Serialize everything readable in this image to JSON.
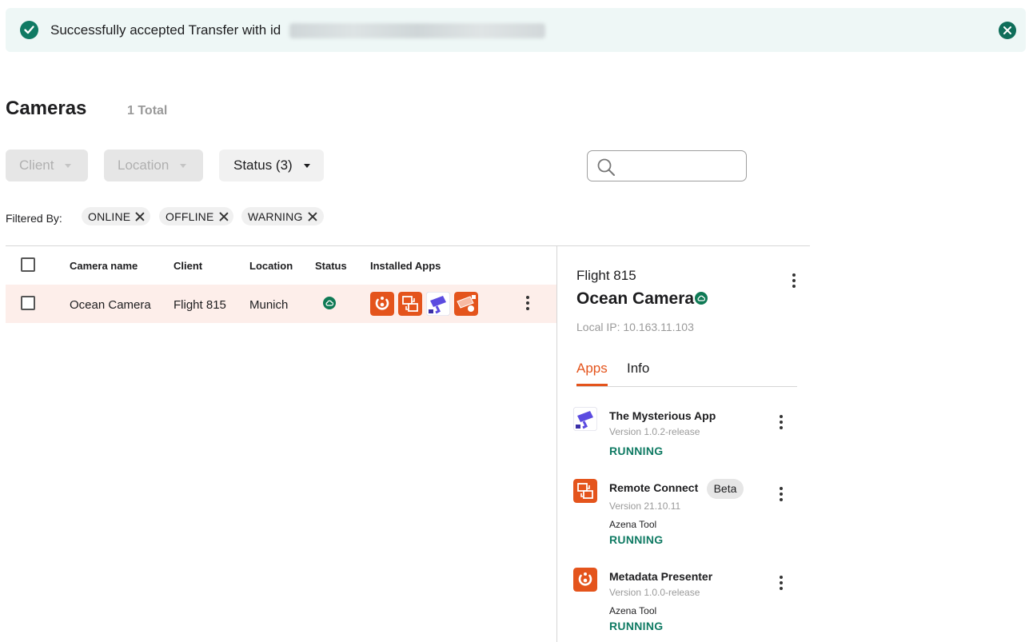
{
  "banner": {
    "message": "Successfully accepted Transfer with id",
    "colors": {
      "background": "#eef7f6",
      "success": "#0f7a63"
    }
  },
  "page": {
    "title": "Cameras",
    "total": "1 Total"
  },
  "filters": {
    "client": "Client",
    "location": "Location",
    "status": "Status (3)",
    "filtered_by": "Filtered By:",
    "chips": [
      "ONLINE",
      "OFFLINE",
      "WARNING"
    ]
  },
  "table": {
    "headers": {
      "name": "Camera name",
      "client": "Client",
      "location": "Location",
      "status": "Status",
      "apps": "Installed Apps"
    },
    "rows": [
      {
        "name": "Ocean Camera",
        "client": "Flight 815",
        "location": "Munich",
        "status": "online-cloud-icon",
        "apps": [
          "metadata-presenter-icon",
          "remote-connect-icon",
          "mysterious-app-icon",
          "camera-app-icon"
        ]
      }
    ],
    "selected_row_color": "#fdeeea"
  },
  "detail": {
    "client": "Flight 815",
    "name": "Ocean Camera",
    "local_ip": "Local IP: 10.163.11.103",
    "tabs": [
      "Apps",
      "Info"
    ],
    "accent": "#e4541c",
    "apps": [
      {
        "name": "The Mysterious App",
        "version": "Version 1.0.2-release",
        "tool": "",
        "status": "RUNNING",
        "icon": "mysterious-app-icon"
      },
      {
        "name": "Remote Connect",
        "badge": "Beta",
        "version": "Version 21.10.11",
        "tool": "Azena Tool",
        "status": "RUNNING",
        "icon": "remote-connect-icon"
      },
      {
        "name": "Metadata Presenter",
        "version": "Version 1.0.0-release",
        "tool": "Azena Tool",
        "status": "RUNNING",
        "icon": "metadata-presenter-icon"
      }
    ]
  }
}
